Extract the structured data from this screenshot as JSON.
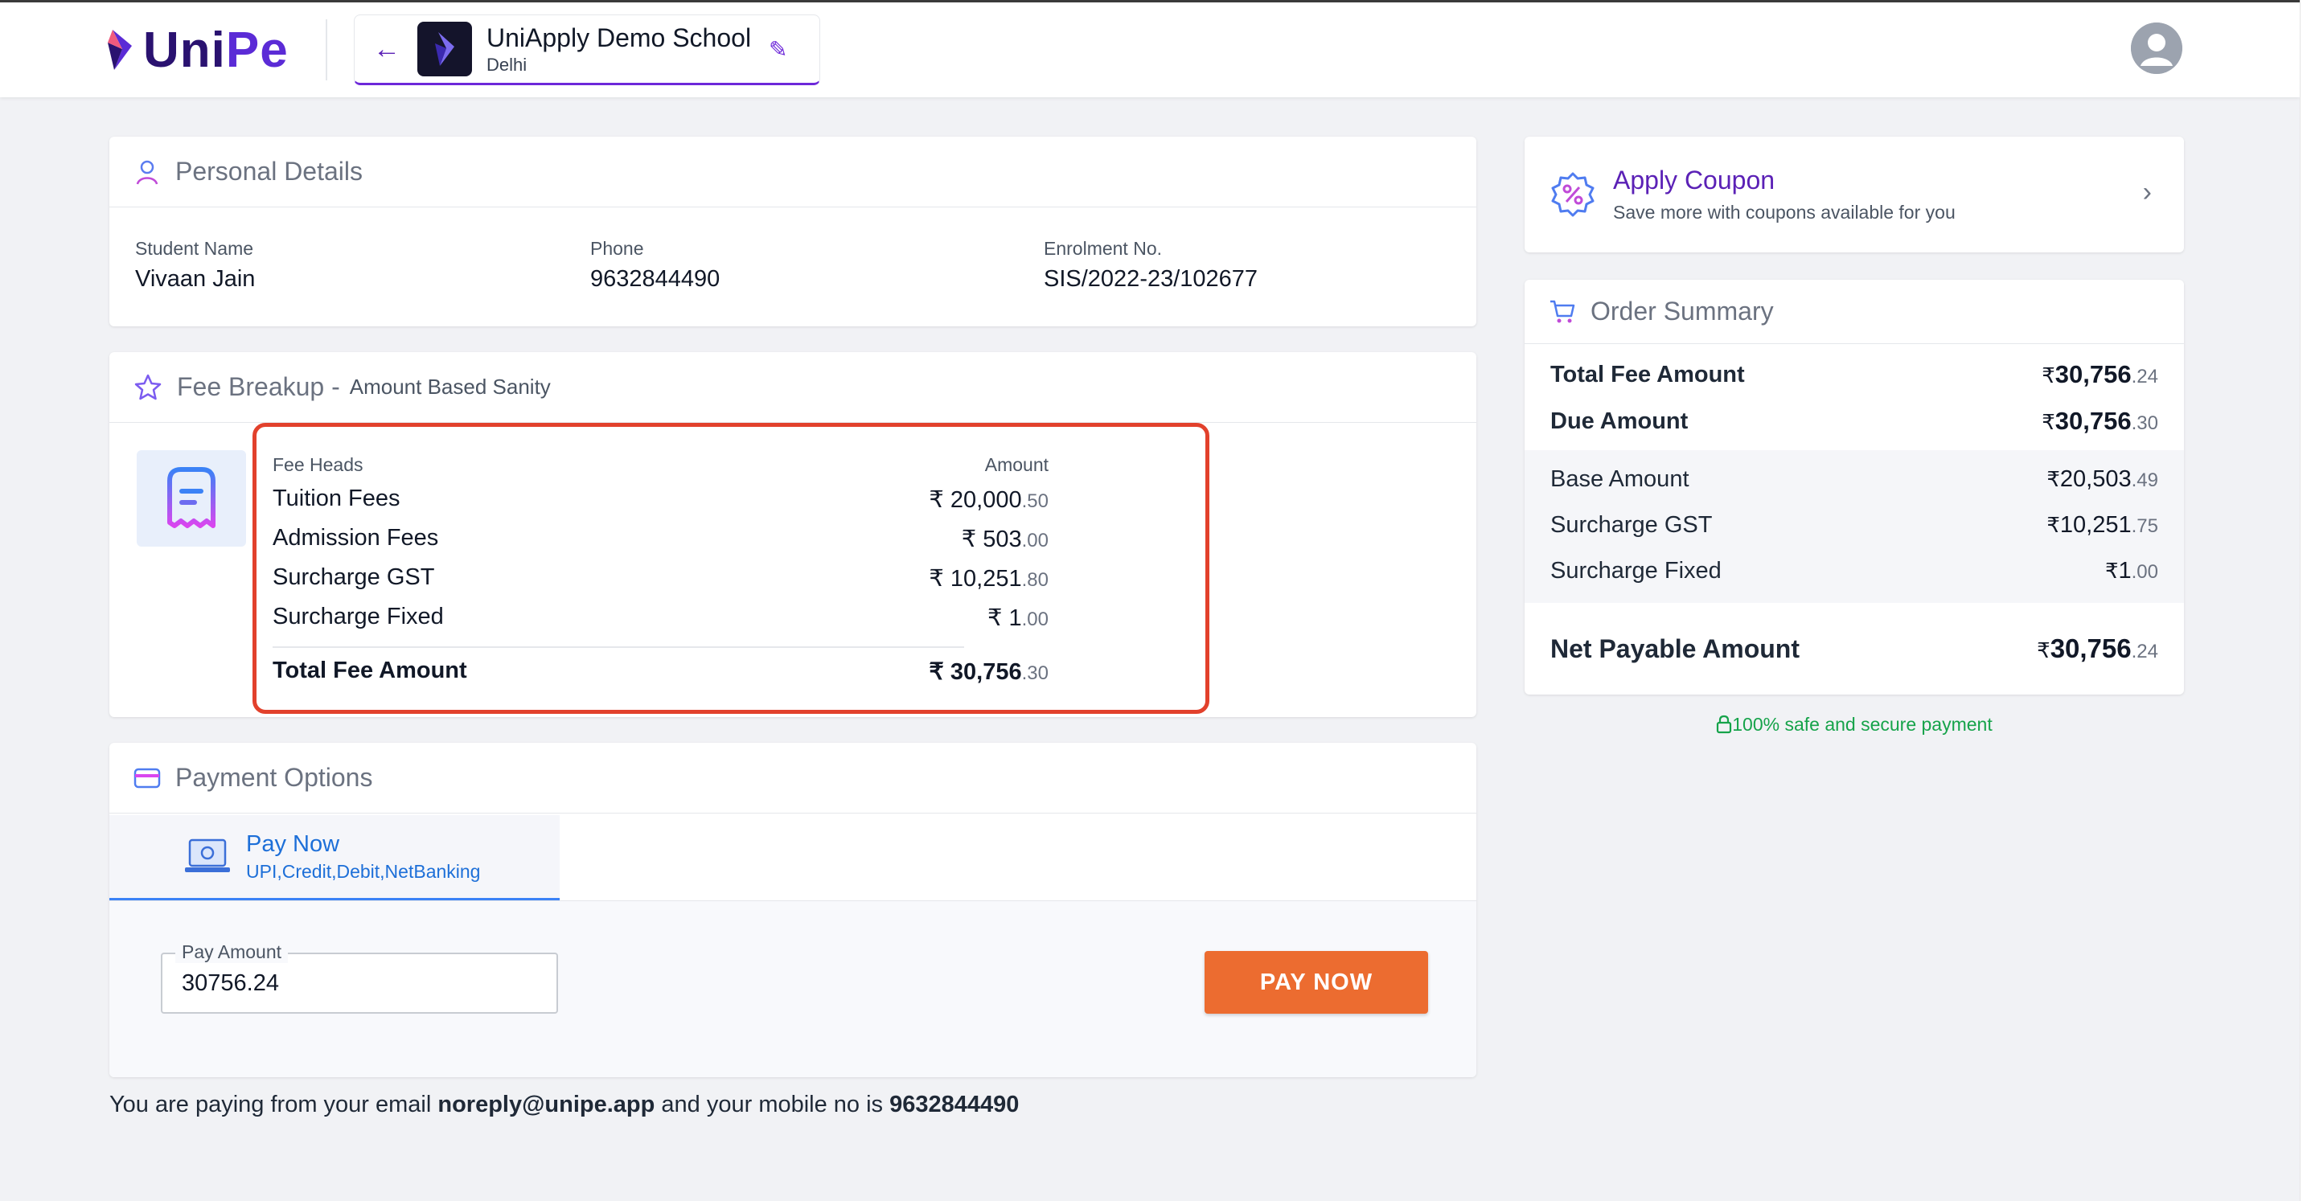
{
  "header": {
    "logo_text_a": "Uni",
    "logo_text_b": "Pe",
    "school_name": "UniApply Demo School",
    "school_city": "Delhi"
  },
  "personal": {
    "title": "Personal Details",
    "fields": [
      {
        "label": "Student Name",
        "value": "Vivaan Jain"
      },
      {
        "label": "Phone",
        "value": "9632844490"
      },
      {
        "label": "Enrolment No.",
        "value": "SIS/2022-23/102677"
      }
    ]
  },
  "fee_breakup": {
    "title": "Fee Breakup -",
    "subtitle": "Amount Based Sanity",
    "col_heads": "Fee Heads",
    "col_amount": "Amount",
    "rows": [
      {
        "head": "Tuition Fees",
        "rs": "₹",
        "whole": "20,000",
        "dec": ".50"
      },
      {
        "head": "Admission Fees",
        "rs": "₹",
        "whole": "503",
        "dec": ".00"
      },
      {
        "head": "Surcharge GST",
        "rs": "₹",
        "whole": "10,251",
        "dec": ".80"
      },
      {
        "head": "Surcharge Fixed",
        "rs": "₹",
        "whole": "1",
        "dec": ".00"
      }
    ],
    "total": {
      "head": "Total Fee Amount",
      "rs": "₹",
      "whole": "30,756",
      "dec": ".30"
    }
  },
  "payment": {
    "title": "Payment Options",
    "tab_title": "Pay Now",
    "tab_sub": "UPI,Credit,Debit,NetBanking",
    "amount_label": "Pay Amount",
    "amount_value": "30756.24",
    "button": "PAY NOW"
  },
  "footer_note": {
    "a": "You are paying from your email ",
    "email": "noreply@unipe.app",
    "b": " and your mobile no is ",
    "phone": "9632844490"
  },
  "coupon": {
    "title": "Apply Coupon",
    "sub": "Save more with coupons available for you"
  },
  "order_summary": {
    "title": "Order Summary",
    "top": [
      {
        "label": "Total Fee Amount",
        "rs": "₹",
        "whole": "30,756",
        "dec": ".24"
      },
      {
        "label": "Due Amount",
        "rs": "₹",
        "whole": "30,756",
        "dec": ".30"
      }
    ],
    "mid": [
      {
        "label": "Base Amount",
        "rs": "₹",
        "whole": "20,503",
        "dec": ".49"
      },
      {
        "label": "Surcharge GST",
        "rs": "₹",
        "whole": "10,251",
        "dec": ".75"
      },
      {
        "label": "Surcharge Fixed",
        "rs": "₹",
        "whole": "1",
        "dec": ".00"
      }
    ],
    "net": {
      "label": "Net Payable Amount",
      "rs": "₹",
      "whole": "30,756",
      "dec": ".24"
    }
  },
  "secure_text": "100% safe and secure payment",
  "colors": {
    "brand": "#5b2bd6",
    "highlight_box": "#e2412c",
    "pay_button": "#ec6c30",
    "secure_green": "#16a34a",
    "link_blue": "#1d6fd8"
  }
}
